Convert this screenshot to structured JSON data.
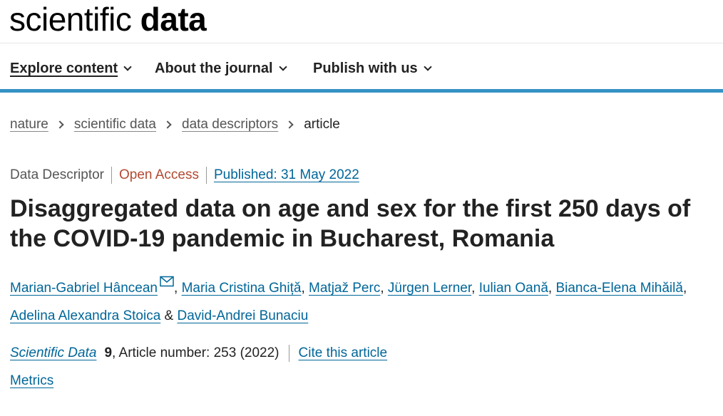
{
  "logo": {
    "light": "scientific",
    "bold": "data"
  },
  "nav": {
    "items": [
      {
        "label": "Explore content"
      },
      {
        "label": "About the journal"
      },
      {
        "label": "Publish with us"
      }
    ]
  },
  "breadcrumb": {
    "items": [
      "nature",
      "scientific data",
      "data descriptors"
    ],
    "current": "article"
  },
  "article": {
    "type": "Data Descriptor",
    "access": "Open Access",
    "published": "Published: 31 May 2022",
    "title": "Disaggregated data on age and sex for the first 250 days of the COVID-19 pandemic in Bucharest, Romania",
    "authors": [
      "Marian-Gabriel Hâncean",
      "Maria Cristina Ghiță",
      "Matjaž Perc",
      "Jürgen Lerner",
      "Iulian Oană",
      "Bianca-Elena Mihăilă",
      "Adelina Alexandra Stoica",
      "David-Andrei Bunaciu"
    ],
    "authors_sep": ", ",
    "authors_last_sep": " & ",
    "citation": {
      "journal": "Scientific Data",
      "volume": "9",
      "rest": ", Article number: 253 (2022)",
      "cite_label": "Cite this article"
    },
    "metrics_label": "Metrics"
  },
  "colors": {
    "link": "#006699",
    "open_access": "#b24a32",
    "nav_border": "#3592c4"
  }
}
